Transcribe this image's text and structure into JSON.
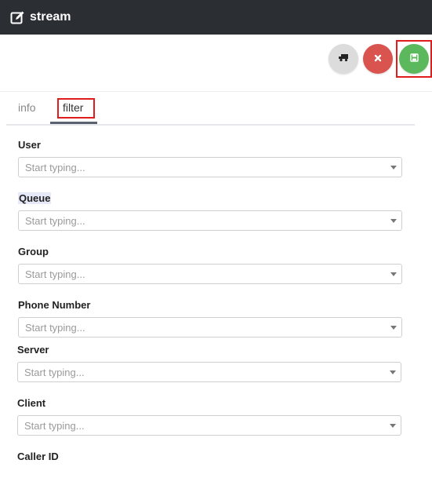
{
  "header": {
    "title": "stream",
    "icon": "edit-icon"
  },
  "actions": {
    "truck": {
      "icon": "truck-icon",
      "color": "#dcdcdc"
    },
    "cancel": {
      "icon": "close-icon",
      "color": "#d9534f"
    },
    "save": {
      "icon": "save-icon",
      "color": "#5cb85c"
    }
  },
  "tabs": [
    {
      "label": "info"
    },
    {
      "label": "filter"
    }
  ],
  "fields": [
    {
      "label": "User",
      "placeholder": "Start typing..."
    },
    {
      "label": "Queue",
      "placeholder": "Start typing..."
    },
    {
      "label": "Group",
      "placeholder": "Start typing..."
    },
    {
      "label": "Phone Number",
      "placeholder": "Start typing..."
    },
    {
      "label": "Server",
      "placeholder": "Start typing..."
    },
    {
      "label": "Client",
      "placeholder": "Start typing..."
    },
    {
      "label": "Caller ID"
    }
  ],
  "colors": {
    "topbar": "#2b2e33",
    "highlight": "#e21c1c"
  }
}
